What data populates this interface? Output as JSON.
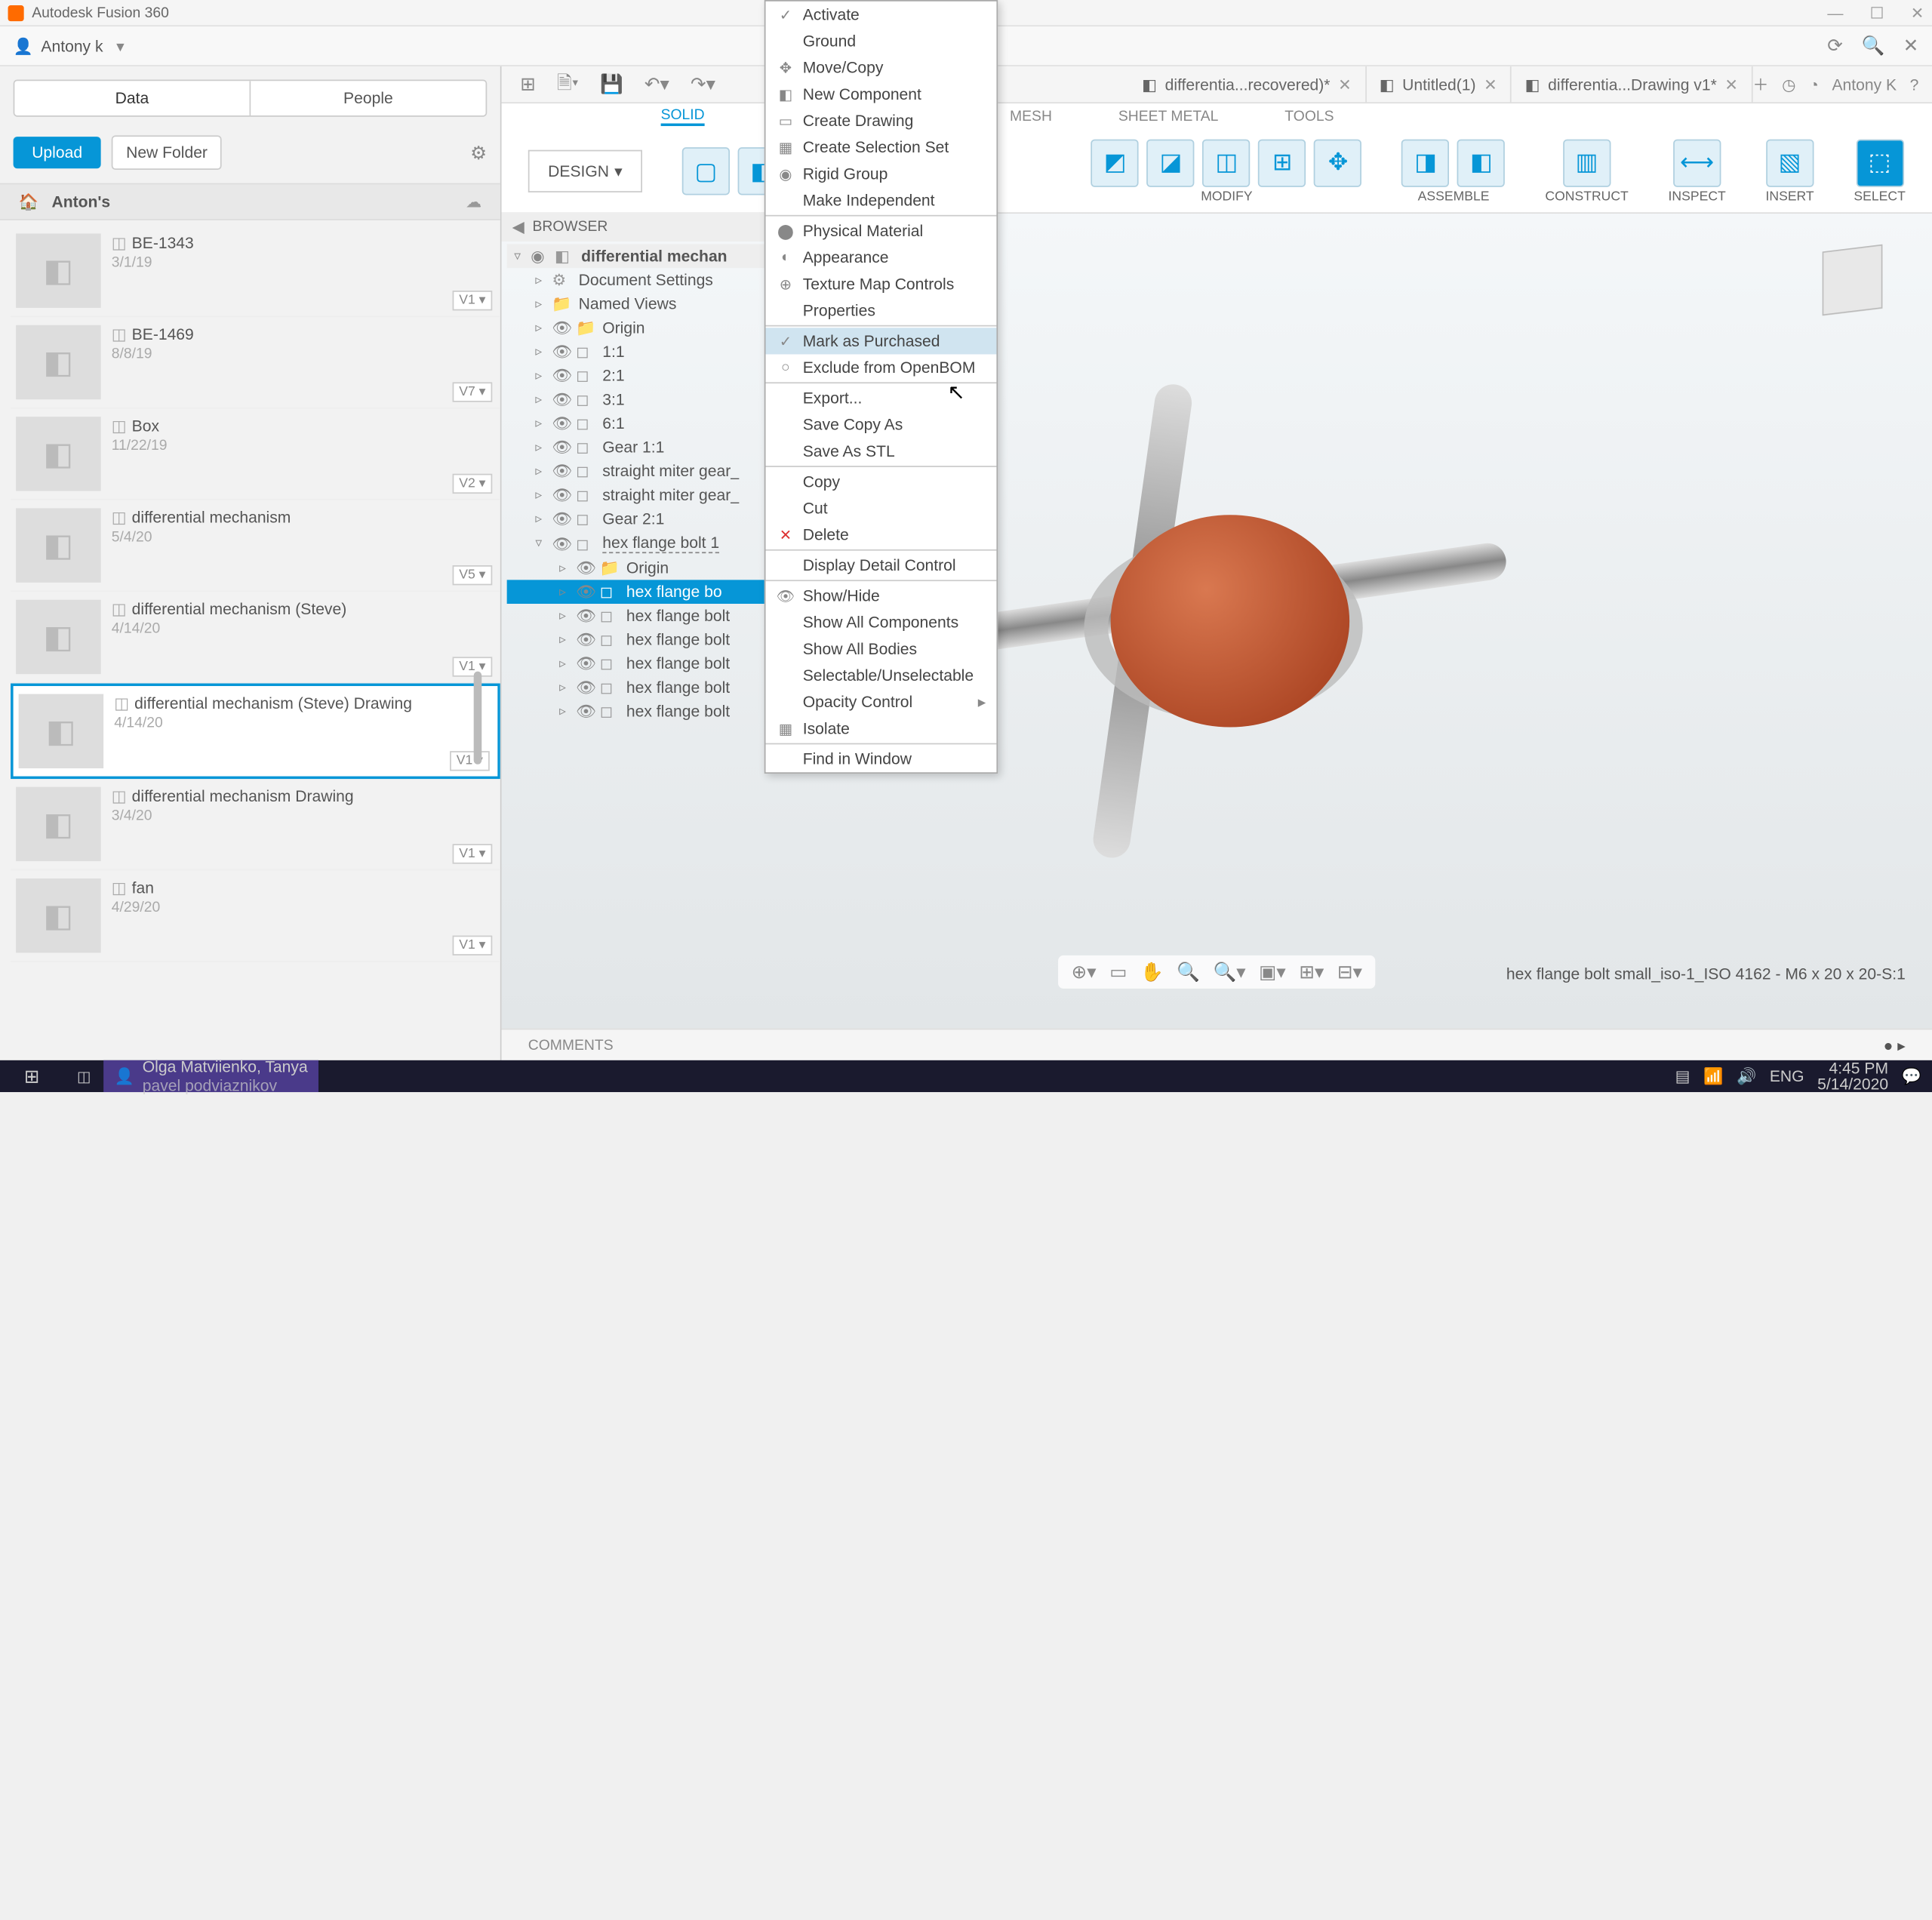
{
  "app": {
    "title": "Autodesk Fusion 360"
  },
  "user": {
    "name": "Antony k"
  },
  "user_right": "Antony K",
  "data_panel": {
    "tabs": {
      "data": "Data",
      "people": "People"
    },
    "upload": "Upload",
    "new_folder": "New Folder",
    "project": "Anton's",
    "files": [
      {
        "name": "BE-1343",
        "date": "3/1/19",
        "ver": "V1"
      },
      {
        "name": "BE-1469",
        "date": "8/8/19",
        "ver": "V7"
      },
      {
        "name": "Box",
        "date": "11/22/19",
        "ver": "V2"
      },
      {
        "name": "differential mechanism",
        "date": "5/4/20",
        "ver": "V5"
      },
      {
        "name": "differential mechanism (Steve)",
        "date": "4/14/20",
        "ver": "V1"
      },
      {
        "name": "differential mechanism (Steve) Drawing",
        "date": "4/14/20",
        "ver": "V1",
        "selected": true
      },
      {
        "name": "differential mechanism Drawing",
        "date": "3/4/20",
        "ver": "V1"
      },
      {
        "name": "fan",
        "date": "4/29/20",
        "ver": "V1"
      }
    ]
  },
  "doc_tabs": [
    {
      "label": "differentia...recovered)*"
    },
    {
      "label": "Untitled(1)"
    },
    {
      "label": "differentia...Drawing v1*"
    }
  ],
  "ribbon": {
    "design": "DESIGN",
    "tabs": {
      "solid": "SOLID",
      "mesh": "MESH",
      "sheet": "SHEET METAL",
      "tools": "TOOLS"
    },
    "groups": {
      "modify": "MODIFY",
      "assemble": "ASSEMBLE",
      "construct": "CONSTRUCT",
      "inspect": "INSPECT",
      "insert": "INSERT",
      "select": "SELECT"
    }
  },
  "browser": {
    "title": "BROWSER",
    "root": "differential mechan",
    "nodes": {
      "doc_settings": "Document Settings",
      "named_views": "Named Views",
      "origin": "Origin",
      "r11": "1:1",
      "r21": "2:1",
      "r31": "3:1",
      "r61": "6:1",
      "gear11": "Gear 1:1",
      "miter1": "straight miter gear_",
      "miter2": "straight miter gear_",
      "gear21": "Gear 2:1",
      "hexbolt_parent": "hex flange bolt 1",
      "origin2": "Origin",
      "hexbolt_sel": "hex flange bo",
      "hexbolt_a": "hex flange bolt",
      "hexbolt_b": "hex flange bolt",
      "hexbolt_c": "hex flange bolt",
      "hexbolt_d": "hex flange bolt",
      "hexbolt_e": "hex flange bolt"
    }
  },
  "context_menu": [
    {
      "label": "Activate",
      "icon": "✓"
    },
    {
      "label": "Ground"
    },
    {
      "label": "Move/Copy",
      "icon": "✥"
    },
    {
      "label": "New Component",
      "icon": "◧"
    },
    {
      "label": "Create Drawing",
      "icon": "▭"
    },
    {
      "label": "Create Selection Set",
      "icon": "▦"
    },
    {
      "label": "Rigid Group",
      "icon": "◉"
    },
    {
      "label": "Make Independent"
    },
    {
      "sep": true
    },
    {
      "label": "Physical Material",
      "icon": "⬤"
    },
    {
      "label": "Appearance",
      "icon": "◐"
    },
    {
      "label": "Texture Map Controls",
      "icon": "⊕"
    },
    {
      "label": "Properties"
    },
    {
      "sep": true
    },
    {
      "label": "Mark as Purchased",
      "icon": "✓",
      "hover": true
    },
    {
      "label": "Exclude from OpenBOM",
      "icon": "○"
    },
    {
      "sep": true
    },
    {
      "label": "Export..."
    },
    {
      "label": "Save Copy As"
    },
    {
      "label": "Save As STL"
    },
    {
      "sep": true
    },
    {
      "label": "Copy"
    },
    {
      "label": "Cut"
    },
    {
      "label": "Delete",
      "icon": "✕",
      "icon_color": "#d33"
    },
    {
      "sep": true
    },
    {
      "label": "Display Detail Control"
    },
    {
      "sep": true
    },
    {
      "label": "Show/Hide",
      "icon": "👁"
    },
    {
      "label": "Show All Components"
    },
    {
      "label": "Show All Bodies"
    },
    {
      "label": "Selectable/Unselectable"
    },
    {
      "label": "Opacity Control",
      "submenu": true
    },
    {
      "label": "Isolate",
      "icon": "▦"
    },
    {
      "sep": true
    },
    {
      "label": "Find in Window"
    }
  ],
  "status": "hex flange bolt small_iso-1_ISO 4162 - M6 x 20 x 20-S:1",
  "comments": "COMMENTS",
  "taskbar": {
    "notif_users": "Olga Matviienko, Tanya",
    "notif_users2": "pavel podviaznikov",
    "lang": "ENG",
    "time": "4:45 PM",
    "date": "5/14/2020"
  }
}
